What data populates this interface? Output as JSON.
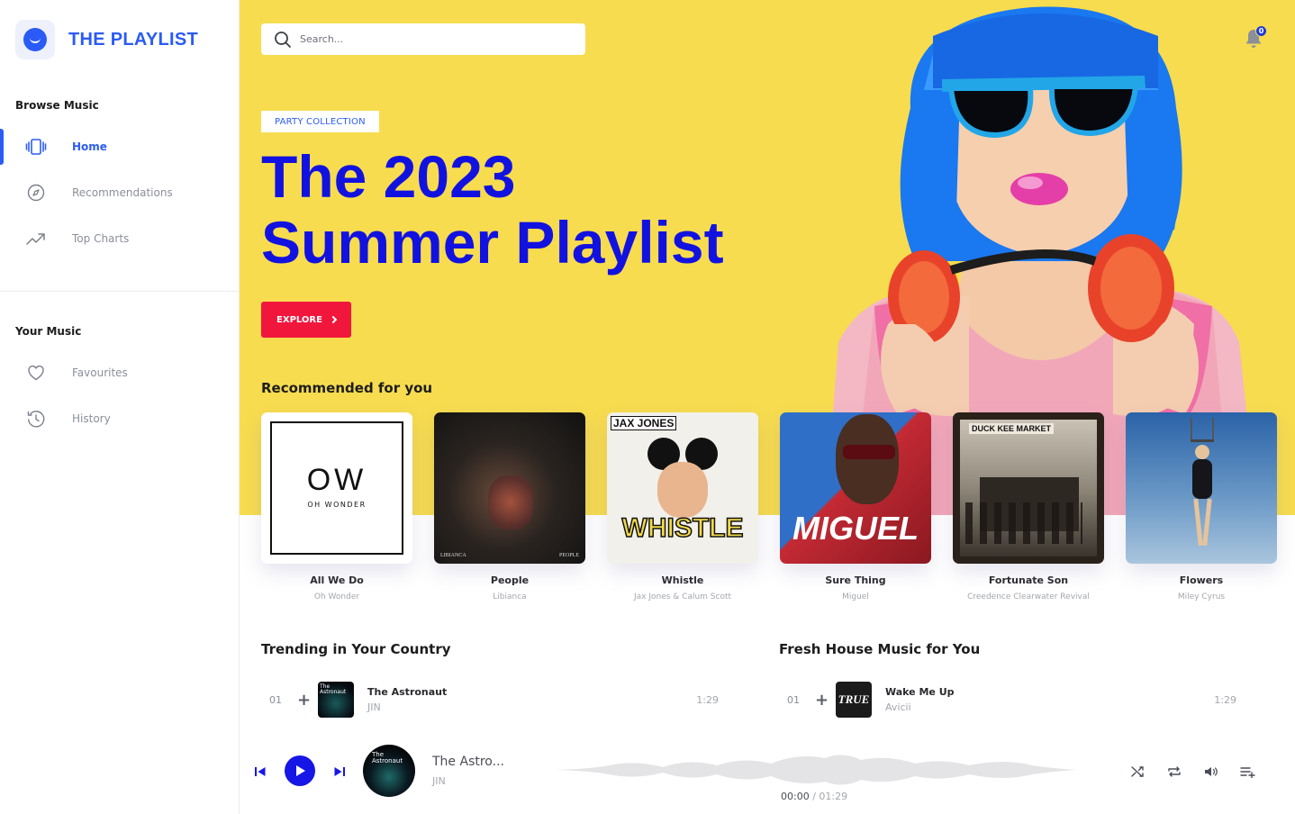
{
  "app": {
    "name": "THE PLAYLIST"
  },
  "sidebar": {
    "browse_title": "Browse Music",
    "browse_items": [
      {
        "label": "Home",
        "icon": "vibrate-icon",
        "active": true
      },
      {
        "label": "Recommendations",
        "icon": "compass-icon",
        "active": false
      },
      {
        "label": "Top Charts",
        "icon": "trending-up-icon",
        "active": false
      }
    ],
    "your_title": "Your Music",
    "your_items": [
      {
        "label": "Favourites",
        "icon": "heart-icon"
      },
      {
        "label": "History",
        "icon": "history-icon"
      }
    ]
  },
  "header": {
    "search_placeholder": "Search...",
    "notification_count": "0"
  },
  "hero": {
    "tag": "PARTY COLLECTION",
    "headline_line1": "The 2023",
    "headline_line2": "Summer Playlist",
    "cta_label": "EXPLORE",
    "background_color": "#f7dc4f",
    "headline_color": "#1212e0",
    "cta_color": "#f0163c"
  },
  "recommended": {
    "title": "Recommended for you",
    "albums": [
      {
        "title": "All We Do",
        "artist": "Oh Wonder",
        "cover_text": "OW",
        "cover_subtext": "OH WONDER"
      },
      {
        "title": "People",
        "artist": "Libianca",
        "cover_text": "LIBIANCA",
        "cover_subtext": "PEOPLE"
      },
      {
        "title": "Whistle",
        "artist": "Jax Jones & Calum Scott",
        "cover_text": "JAX JONES",
        "cover_subtext": "WHISTLE"
      },
      {
        "title": "Sure Thing",
        "artist": "Miguel",
        "cover_text": "MIGUEL",
        "cover_subtext": ""
      },
      {
        "title": "Fortunate Son",
        "artist": "Creedence Clearwater Revival",
        "cover_text": "DUCK KEE MARKET",
        "cover_subtext": ""
      },
      {
        "title": "Flowers",
        "artist": "Miley Cyrus",
        "cover_text": "",
        "cover_subtext": ""
      }
    ]
  },
  "trending": {
    "title": "Trending in Your Country",
    "tracks": [
      {
        "num": "01",
        "title": "The Astronaut",
        "artist": "JIN",
        "duration": "1:29",
        "cover_text": "The Astronaut"
      }
    ]
  },
  "house": {
    "title": "Fresh House Music for You",
    "tracks": [
      {
        "num": "01",
        "title": "Wake Me Up",
        "artist": "Avicii",
        "duration": "1:29",
        "cover_text": "TRUE"
      }
    ]
  },
  "player": {
    "title": "The Astro...",
    "artist": "JIN",
    "current_time": "00:00",
    "total_time": "01:29",
    "cover_text": "The Astronaut"
  }
}
